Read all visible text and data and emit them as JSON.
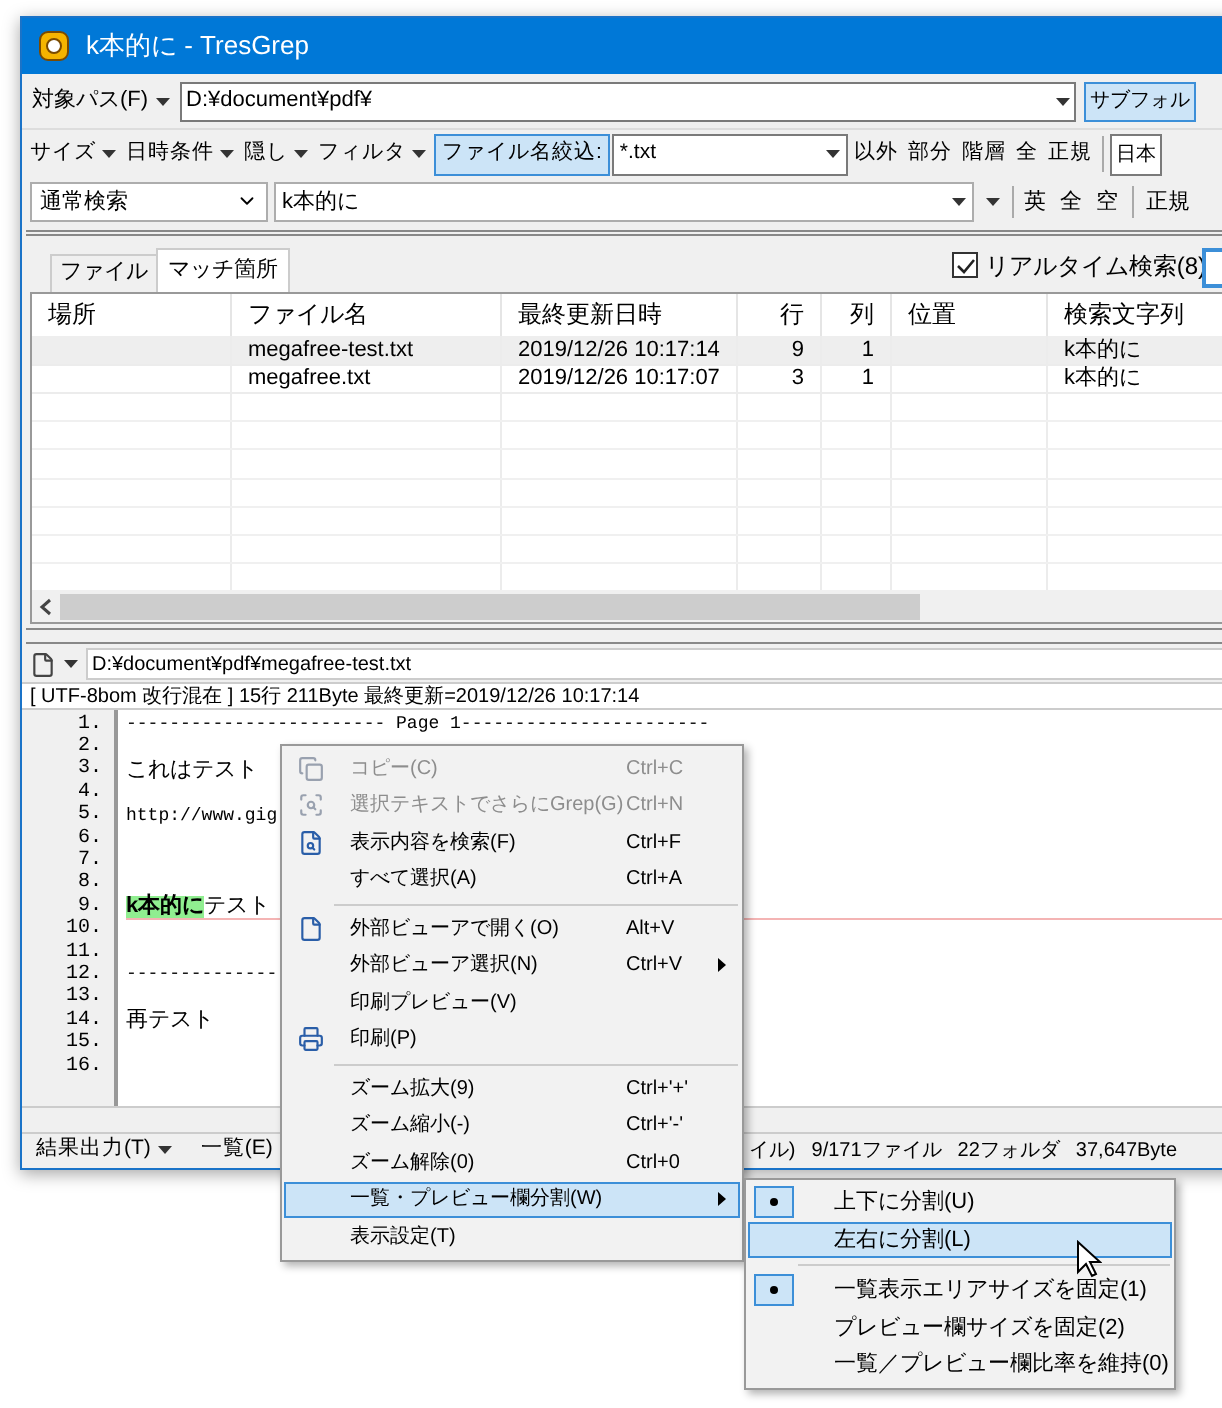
{
  "window": {
    "title": "k本的に - TresGrep"
  },
  "path_bar": {
    "label": "対象パス(F)",
    "value": "D:¥document¥pdf¥",
    "subfolder_button": "サブフォル"
  },
  "filter_bar": {
    "menus": [
      "サイズ",
      "日時条件",
      "隠し",
      "フィルタ"
    ],
    "filename_button": "ファイル名絞込:",
    "filename_value": "*.txt",
    "toggles": [
      "以外",
      "部分",
      "階層",
      "全",
      "正規"
    ],
    "encoding": "日本"
  },
  "search_bar": {
    "mode": "通常検索",
    "query": "k本的に",
    "toggles": [
      "英",
      "全",
      "空"
    ],
    "regex": "正規"
  },
  "tabs": [
    {
      "label": "ファイル",
      "selected": false
    },
    {
      "label": "マッチ箇所",
      "selected": true
    }
  ],
  "realtime": {
    "label": "リアルタイム検索(8)",
    "checked": true
  },
  "table": {
    "columns": [
      "場所",
      "ファイル名",
      "最終更新日時",
      "行",
      "列",
      "位置",
      "検索文字列"
    ],
    "rows": [
      {
        "cells": [
          "",
          "megafree-test.txt",
          "2019/12/26  10:17:14",
          "9",
          "1",
          "",
          "k本的に"
        ],
        "selected": true
      },
      {
        "cells": [
          "",
          "megafree.txt",
          "2019/12/26  10:17:07",
          "3",
          "1",
          "",
          "k本的に"
        ],
        "selected": false
      }
    ]
  },
  "preview": {
    "path": "D:¥document¥pdf¥megafree-test.txt",
    "info": "[ UTF-8bom 改行混在 ] 15行 211Byte 最終更新=2019/12/26 10:17:14",
    "lines": [
      {
        "number": "1.",
        "text": "------------------------ Page 1-----------------------",
        "current": false
      },
      {
        "number": "2.",
        "current": false
      },
      {
        "number": "3.",
        "text": "これはテスト",
        "current": false
      },
      {
        "number": "4.",
        "current": false
      },
      {
        "number": "5.",
        "text": "http://www.gig",
        "current": false
      },
      {
        "number": "6.",
        "current": false
      },
      {
        "number": "7.",
        "current": false
      },
      {
        "number": "8.",
        "current": false
      },
      {
        "number": "9.",
        "match": "k本的に",
        "text": "テスト",
        "current": true
      },
      {
        "number": "10.",
        "current": false
      },
      {
        "number": "11.",
        "current": false
      },
      {
        "number": "12.",
        "text": "--------------",
        "current": false
      },
      {
        "number": "13.",
        "current": false
      },
      {
        "number": "14.",
        "text": "再テスト",
        "current": false
      },
      {
        "number": "15.",
        "current": false
      },
      {
        "number": "16.",
        "current": false
      }
    ]
  },
  "status_bar": {
    "menus": [
      "結果出力(T)",
      "一覧(E)"
    ],
    "items": [
      "イル)",
      "9/171ファイル",
      "22フォルダ",
      "37,647Byte"
    ]
  },
  "context_menu": [
    {
      "kind": "item",
      "label": "コピー(C)",
      "shortcut": "Ctrl+C",
      "disabled": true,
      "selected": false
    },
    {
      "kind": "item",
      "label": "選択テキストでさらにGrep(G)",
      "shortcut": "Ctrl+N",
      "disabled": true,
      "selected": false
    },
    {
      "kind": "item",
      "label": "表示内容を検索(F)",
      "shortcut": "Ctrl+F",
      "disabled": false,
      "selected": false
    },
    {
      "kind": "item",
      "label": "すべて選択(A)",
      "shortcut": "Ctrl+A",
      "disabled": false,
      "selected": false
    },
    {
      "kind": "separator"
    },
    {
      "kind": "item",
      "label": "外部ビューアで開く(O)",
      "shortcut": "Alt+V",
      "disabled": false,
      "selected": false
    },
    {
      "kind": "submenu",
      "label": "外部ビューア選択(N)",
      "shortcut": "Ctrl+V",
      "disabled": false,
      "selected": false
    },
    {
      "kind": "item",
      "label": "印刷プレビュー(V)",
      "disabled": false,
      "selected": false
    },
    {
      "kind": "item",
      "label": "印刷(P)",
      "disabled": false,
      "selected": false
    },
    {
      "kind": "separator"
    },
    {
      "kind": "item",
      "label": "ズーム拡大(9)",
      "shortcut": "Ctrl+'+'",
      "disabled": false,
      "selected": false
    },
    {
      "kind": "item",
      "label": "ズーム縮小(-)",
      "shortcut": "Ctrl+'-'",
      "disabled": false,
      "selected": false
    },
    {
      "kind": "item",
      "label": "ズーム解除(0)",
      "shortcut": "Ctrl+0",
      "disabled": false,
      "selected": false
    },
    {
      "kind": "submenu",
      "label": "一覧・プレビュー欄分割(W)",
      "disabled": false,
      "selected": true
    },
    {
      "kind": "item",
      "label": "表示設定(T)",
      "disabled": false,
      "selected": false
    }
  ],
  "submenu": [
    {
      "kind": "item",
      "label": "上下に分割(U)",
      "checked": true,
      "selected": false
    },
    {
      "kind": "item",
      "label": "左右に分割(L)",
      "checked": false,
      "selected": true
    },
    {
      "kind": "separator"
    },
    {
      "kind": "item",
      "label": "一覧表示エリアサイズを固定(1)",
      "checked": true,
      "selected": false
    },
    {
      "kind": "item",
      "label": "プレビュー欄サイズを固定(2)",
      "checked": false,
      "selected": false
    },
    {
      "kind": "item",
      "label": "一覧／プレビュー欄比率を維持(0)",
      "checked": false,
      "selected": false
    }
  ]
}
